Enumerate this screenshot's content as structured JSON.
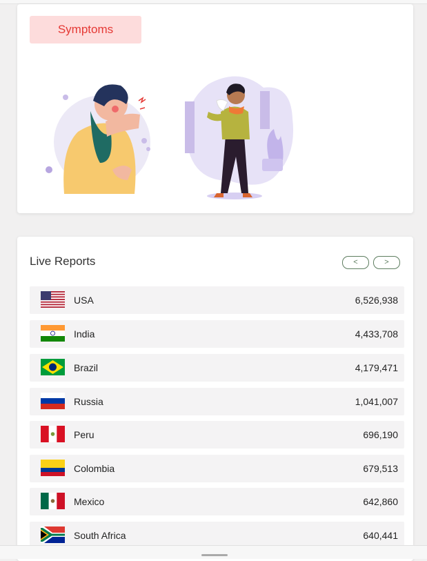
{
  "symptoms": {
    "label": "Symptoms"
  },
  "reports": {
    "title": "Live Reports",
    "prev_label": "<",
    "next_label": ">",
    "rows": [
      {
        "country": "USA",
        "count": "6,526,938",
        "flag": "usa-flag-icon"
      },
      {
        "country": "India",
        "count": "4,433,708",
        "flag": "india-flag-icon"
      },
      {
        "country": "Brazil",
        "count": "4,179,471",
        "flag": "brazil-flag-icon"
      },
      {
        "country": "Russia",
        "count": "1,041,007",
        "flag": "russia-flag-icon"
      },
      {
        "country": "Peru",
        "count": "696,190",
        "flag": "peru-flag-icon"
      },
      {
        "country": "Colombia",
        "count": "679,513",
        "flag": "colombia-flag-icon"
      },
      {
        "country": "Mexico",
        "count": "642,860",
        "flag": "mexico-flag-icon"
      },
      {
        "country": "South Africa",
        "count": "640,441",
        "flag": "south-africa-flag-icon"
      }
    ]
  },
  "colors": {
    "accent_red": "#e53935",
    "badge_bg": "#fddcdc",
    "nav_green": "#5d7d5f",
    "row_bg": "#f4f3f4"
  }
}
